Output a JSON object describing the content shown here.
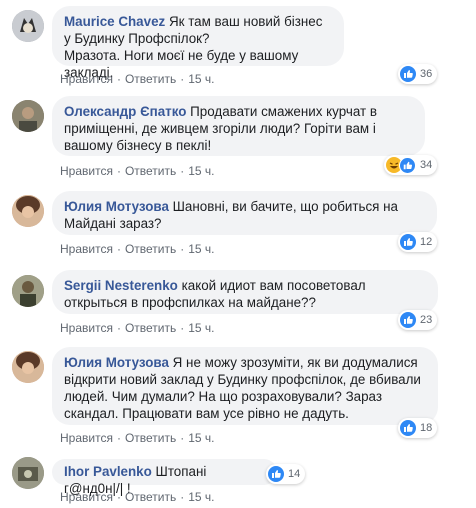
{
  "action_labels": {
    "like": "Нравится",
    "reply": "Ответить"
  },
  "comments": [
    {
      "author": "Maurice Chavez",
      "text": "Як там ваш новий бізнес у Будинку Профспілок?\nМразота. Ноги моєї не буде у вашому закладі.",
      "time": "15 ч.",
      "reactions": {
        "icons": [
          "like-icon"
        ],
        "count": "36"
      }
    },
    {
      "author": "Олександр Єпатко",
      "text": "Продавати смажених курчат в приміщенні, де живцем згоріли люди? Горіти вам і вашому бізнесу в пеклі!",
      "time": "15 ч.",
      "reactions": {
        "icons": [
          "haha-icon",
          "like-icon"
        ],
        "count": "34"
      }
    },
    {
      "author": "Юлия Мотузова",
      "text": "Шановні, ви бачите, що робиться на Майдані зараз?",
      "time": "15 ч.",
      "reactions": {
        "icons": [
          "like-icon"
        ],
        "count": "12"
      }
    },
    {
      "author": "Sergii Nesterenko",
      "text": "какой идиот вам посоветовал открыться в профспилках на майдане??",
      "time": "15 ч.",
      "reactions": {
        "icons": [
          "like-icon"
        ],
        "count": "23"
      }
    },
    {
      "author": "Юлия Мотузова",
      "text": "Я не можу зрозуміти, як ви додумалися відкрити новий заклад у Будинку профспілок, де вбивали людей. Чим думали? На що розраховували? Зараз скандал. Працювати вам усе рівно не дадуть.",
      "time": "15 ч.",
      "reactions": {
        "icons": [
          "like-icon"
        ],
        "count": "18"
      }
    },
    {
      "author": "Ihor Pavlenko",
      "text": "Штопані г@нд0н|/| !",
      "time": "15 ч.",
      "reactions": {
        "icons": [
          "like-icon"
        ],
        "count": "14"
      }
    }
  ]
}
